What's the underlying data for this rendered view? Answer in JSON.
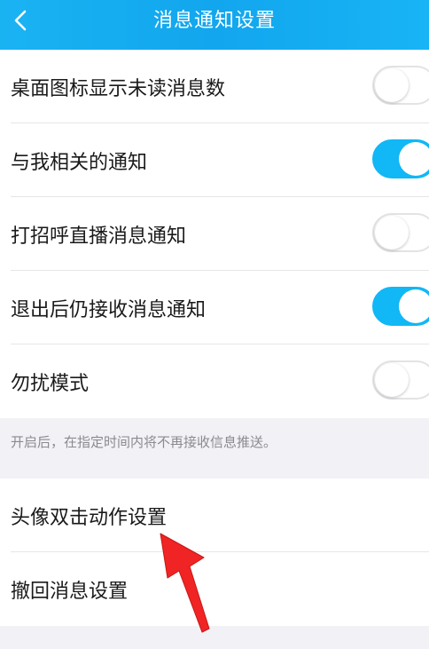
{
  "header": {
    "title": "消息通知设置",
    "back_icon": "chevron-left-icon"
  },
  "notifications": [
    {
      "label": "桌面图标显示未读消息数",
      "enabled": false
    },
    {
      "label": "与我相关的通知",
      "enabled": true
    },
    {
      "label": "打招呼直播消息通知",
      "enabled": false
    },
    {
      "label": "退出后仍接收消息通知",
      "enabled": true
    },
    {
      "label": "勿扰模式",
      "enabled": false
    }
  ],
  "dnd_hint": "开启后，在指定时间内将不再接收信息推送。",
  "other_settings": [
    {
      "label": "头像双击动作设置"
    },
    {
      "label": "撤回消息设置"
    }
  ],
  "colors": {
    "header": "#12a6ee",
    "toggle_on": "#12b7f5",
    "arrow": "#f02424"
  }
}
